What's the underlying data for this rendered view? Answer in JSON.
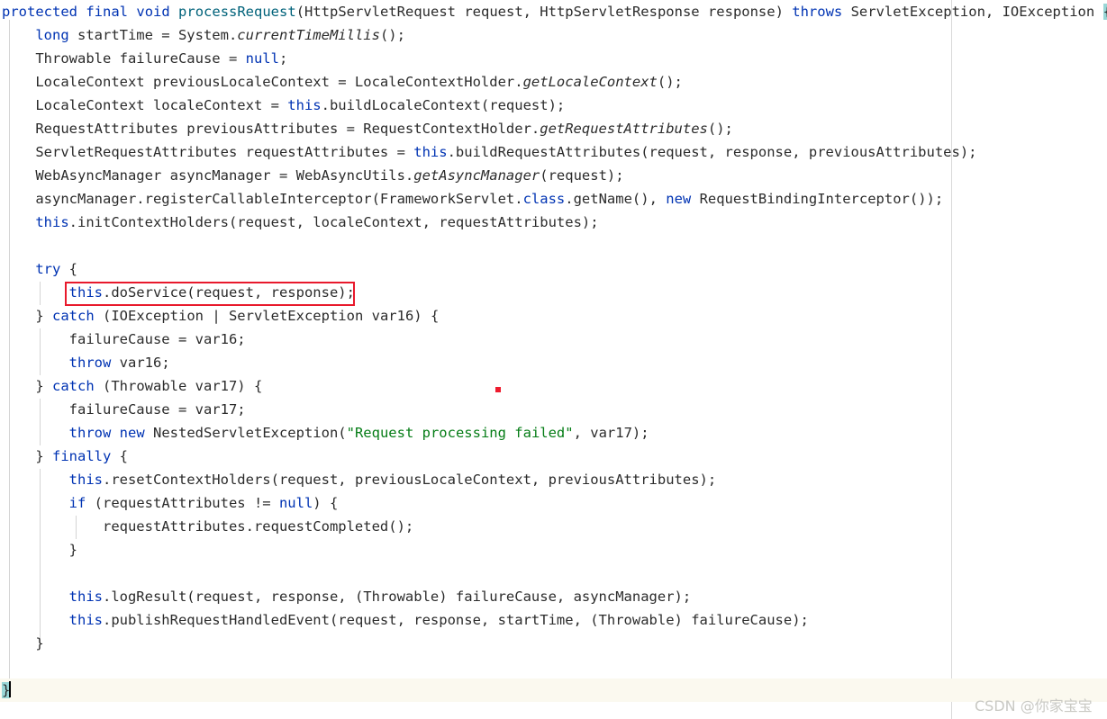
{
  "editor": {
    "language": "java",
    "background_color": "#ffffff",
    "current_line_color": "#fbf9ef",
    "brace_match_color": "#99d6d6",
    "keyword_color": "#0033b3",
    "string_color": "#067d17",
    "method_decl_color": "#00627a",
    "text_color": "#2b2b2b",
    "guide_color": "#d4d4d4",
    "annotation_color": "#e8192c",
    "line_height": 26,
    "font_size": 15.5
  },
  "annotation": {
    "label": "highlighted-call",
    "target_text": "this.doService(request, response);"
  },
  "watermark": {
    "text": "CSDN @你家宝宝"
  },
  "code": {
    "lines": [
      {
        "n": 1,
        "indent": 0,
        "tokens": [
          {
            "t": "protected",
            "c": "kw"
          },
          {
            "t": " ",
            "c": "pln"
          },
          {
            "t": "final",
            "c": "kw"
          },
          {
            "t": " ",
            "c": "pln"
          },
          {
            "t": "void",
            "c": "kw"
          },
          {
            "t": " ",
            "c": "pln"
          },
          {
            "t": "processRequest",
            "c": "fn"
          },
          {
            "t": "(HttpServletRequest request, HttpServletResponse response) ",
            "c": "pln"
          },
          {
            "t": "throws",
            "c": "kw"
          },
          {
            "t": " ServletException, IOException ",
            "c": "pln"
          },
          {
            "t": "{",
            "c": "brace-match"
          }
        ]
      },
      {
        "n": 2,
        "indent": 0,
        "tokens": [
          {
            "t": "    ",
            "c": "pln"
          },
          {
            "t": "long",
            "c": "kw"
          },
          {
            "t": " startTime = System.",
            "c": "pln"
          },
          {
            "t": "currentTimeMillis",
            "c": "stat"
          },
          {
            "t": "();",
            "c": "pln"
          }
        ]
      },
      {
        "n": 3,
        "indent": 0,
        "tokens": [
          {
            "t": "    Throwable failureCause = ",
            "c": "pln"
          },
          {
            "t": "null",
            "c": "kw"
          },
          {
            "t": ";",
            "c": "pln"
          }
        ]
      },
      {
        "n": 4,
        "indent": 0,
        "tokens": [
          {
            "t": "    LocaleContext previousLocaleContext = LocaleContextHolder.",
            "c": "pln"
          },
          {
            "t": "getLocaleContext",
            "c": "stat"
          },
          {
            "t": "();",
            "c": "pln"
          }
        ]
      },
      {
        "n": 5,
        "indent": 0,
        "tokens": [
          {
            "t": "    LocaleContext localeContext = ",
            "c": "pln"
          },
          {
            "t": "this",
            "c": "ths"
          },
          {
            "t": ".buildLocaleContext(request);",
            "c": "pln"
          }
        ]
      },
      {
        "n": 6,
        "indent": 0,
        "tokens": [
          {
            "t": "    RequestAttributes previousAttributes = RequestContextHolder.",
            "c": "pln"
          },
          {
            "t": "getRequestAttributes",
            "c": "stat"
          },
          {
            "t": "();",
            "c": "pln"
          }
        ]
      },
      {
        "n": 7,
        "indent": 0,
        "tokens": [
          {
            "t": "    ServletRequestAttributes requestAttributes = ",
            "c": "pln"
          },
          {
            "t": "this",
            "c": "ths"
          },
          {
            "t": ".buildRequestAttributes(request, response, previousAttributes);",
            "c": "pln"
          }
        ]
      },
      {
        "n": 8,
        "indent": 0,
        "tokens": [
          {
            "t": "    WebAsyncManager asyncManager = WebAsyncUtils.",
            "c": "pln"
          },
          {
            "t": "getAsyncManager",
            "c": "stat"
          },
          {
            "t": "(request);",
            "c": "pln"
          }
        ]
      },
      {
        "n": 9,
        "indent": 0,
        "tokens": [
          {
            "t": "    asyncManager.registerCallableInterceptor(FrameworkServlet.",
            "c": "pln"
          },
          {
            "t": "class",
            "c": "kw"
          },
          {
            "t": ".getName(), ",
            "c": "pln"
          },
          {
            "t": "new",
            "c": "kw"
          },
          {
            "t": " RequestBindingInterceptor());",
            "c": "pln"
          }
        ]
      },
      {
        "n": 10,
        "indent": 0,
        "tokens": [
          {
            "t": "    ",
            "c": "pln"
          },
          {
            "t": "this",
            "c": "ths"
          },
          {
            "t": ".initContextHolders(request, localeContext, requestAttributes);",
            "c": "pln"
          }
        ]
      },
      {
        "n": 11,
        "indent": 0,
        "tokens": []
      },
      {
        "n": 12,
        "indent": 0,
        "tokens": [
          {
            "t": "    ",
            "c": "pln"
          },
          {
            "t": "try",
            "c": "kw"
          },
          {
            "t": " {",
            "c": "pln"
          }
        ]
      },
      {
        "n": 13,
        "indent": 0,
        "tokens": [
          {
            "t": "        ",
            "c": "pln"
          },
          {
            "t": "this",
            "c": "ths"
          },
          {
            "t": ".doService(request, response);",
            "c": "pln"
          }
        ]
      },
      {
        "n": 14,
        "indent": 0,
        "tokens": [
          {
            "t": "    } ",
            "c": "pln"
          },
          {
            "t": "catch",
            "c": "kw"
          },
          {
            "t": " (IOException | ServletException var16) {",
            "c": "pln"
          }
        ]
      },
      {
        "n": 15,
        "indent": 0,
        "tokens": [
          {
            "t": "        failureCause = var16;",
            "c": "pln"
          }
        ]
      },
      {
        "n": 16,
        "indent": 0,
        "tokens": [
          {
            "t": "        ",
            "c": "pln"
          },
          {
            "t": "throw",
            "c": "kw"
          },
          {
            "t": " var16;",
            "c": "pln"
          }
        ]
      },
      {
        "n": 17,
        "indent": 0,
        "tokens": [
          {
            "t": "    } ",
            "c": "pln"
          },
          {
            "t": "catch",
            "c": "kw"
          },
          {
            "t": " (Throwable var17) {",
            "c": "pln"
          }
        ]
      },
      {
        "n": 18,
        "indent": 0,
        "tokens": [
          {
            "t": "        failureCause = var17;",
            "c": "pln"
          }
        ]
      },
      {
        "n": 19,
        "indent": 0,
        "tokens": [
          {
            "t": "        ",
            "c": "pln"
          },
          {
            "t": "throw",
            "c": "kw"
          },
          {
            "t": " ",
            "c": "pln"
          },
          {
            "t": "new",
            "c": "kw"
          },
          {
            "t": " NestedServletException(",
            "c": "pln"
          },
          {
            "t": "\"Request processing failed\"",
            "c": "str"
          },
          {
            "t": ", var17);",
            "c": "pln"
          }
        ]
      },
      {
        "n": 20,
        "indent": 0,
        "tokens": [
          {
            "t": "    } ",
            "c": "pln"
          },
          {
            "t": "finally",
            "c": "kw"
          },
          {
            "t": " {",
            "c": "pln"
          }
        ]
      },
      {
        "n": 21,
        "indent": 0,
        "tokens": [
          {
            "t": "        ",
            "c": "pln"
          },
          {
            "t": "this",
            "c": "ths"
          },
          {
            "t": ".resetContextHolders(request, previousLocaleContext, previousAttributes);",
            "c": "pln"
          }
        ]
      },
      {
        "n": 22,
        "indent": 0,
        "tokens": [
          {
            "t": "        ",
            "c": "pln"
          },
          {
            "t": "if",
            "c": "kw"
          },
          {
            "t": " (requestAttributes != ",
            "c": "pln"
          },
          {
            "t": "null",
            "c": "kw"
          },
          {
            "t": ") {",
            "c": "pln"
          }
        ]
      },
      {
        "n": 23,
        "indent": 0,
        "tokens": [
          {
            "t": "            requestAttributes.requestCompleted();",
            "c": "pln"
          }
        ]
      },
      {
        "n": 24,
        "indent": 0,
        "tokens": [
          {
            "t": "        }",
            "c": "pln"
          }
        ]
      },
      {
        "n": 25,
        "indent": 0,
        "tokens": []
      },
      {
        "n": 26,
        "indent": 0,
        "tokens": [
          {
            "t": "        ",
            "c": "pln"
          },
          {
            "t": "this",
            "c": "ths"
          },
          {
            "t": ".logResult(request, response, (Throwable) failureCause, asyncManager);",
            "c": "pln"
          }
        ]
      },
      {
        "n": 27,
        "indent": 0,
        "tokens": [
          {
            "t": "        ",
            "c": "pln"
          },
          {
            "t": "this",
            "c": "ths"
          },
          {
            "t": ".publishRequestHandledEvent(request, response, startTime, (Throwable) failureCause);",
            "c": "pln"
          }
        ]
      },
      {
        "n": 28,
        "indent": 0,
        "tokens": [
          {
            "t": "    }",
            "c": "pln"
          }
        ]
      },
      {
        "n": 29,
        "indent": 0,
        "tokens": []
      },
      {
        "n": 30,
        "indent": 0,
        "current": true,
        "caret": true,
        "tokens": [
          {
            "t": "}",
            "c": "brace-match"
          }
        ]
      }
    ]
  }
}
